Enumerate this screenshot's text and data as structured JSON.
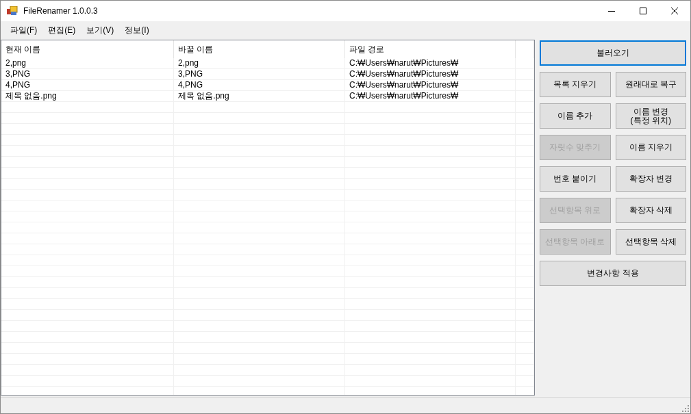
{
  "window": {
    "title": "FileRenamer 1.0.0.3"
  },
  "menu": [
    {
      "label": "파일(F)"
    },
    {
      "label": "편집(E)"
    },
    {
      "label": "보기(V)"
    },
    {
      "label": "정보(I)"
    }
  ],
  "table": {
    "columns": [
      "현재 이름",
      "바꿀 이름",
      "파일 경로"
    ],
    "rows": [
      [
        "2,png",
        "2,png",
        "C:₩Users₩narut₩Pictures₩"
      ],
      [
        "3,PNG",
        "3,PNG",
        "C:₩Users₩narut₩Pictures₩"
      ],
      [
        "4,PNG",
        "4,PNG",
        "C:₩Users₩narut₩Pictures₩"
      ],
      [
        "제목 없음.png",
        "제목 없음.png",
        "C:₩Users₩narut₩Pictures₩"
      ]
    ]
  },
  "buttons": [
    {
      "kind": "wide",
      "label": "불러오기",
      "disabled": false,
      "focused": true
    },
    {
      "kind": "half",
      "label": "목록 지우기",
      "disabled": false,
      "focused": false
    },
    {
      "kind": "half",
      "label": "원래대로 복구",
      "disabled": false,
      "focused": false
    },
    {
      "kind": "half",
      "label": "이름 추가",
      "disabled": false,
      "focused": false
    },
    {
      "kind": "half",
      "label": "이름 변경\n(특정 위치)",
      "disabled": false,
      "focused": false
    },
    {
      "kind": "half",
      "label": "자릿수 맞추기",
      "disabled": true,
      "focused": false
    },
    {
      "kind": "half",
      "label": "이름 지우기",
      "disabled": false,
      "focused": false
    },
    {
      "kind": "half",
      "label": "번호 붙이기",
      "disabled": false,
      "focused": false
    },
    {
      "kind": "half",
      "label": "확장자 변경",
      "disabled": false,
      "focused": false
    },
    {
      "kind": "half",
      "label": "선택항목 위로",
      "disabled": true,
      "focused": false
    },
    {
      "kind": "half",
      "label": "확장자 삭제",
      "disabled": false,
      "focused": false
    },
    {
      "kind": "half",
      "label": "선택항목 아래로",
      "disabled": true,
      "focused": false
    },
    {
      "kind": "half",
      "label": "선택항목 삭제",
      "disabled": false,
      "focused": false
    },
    {
      "kind": "wide",
      "label": "변경사항 적용",
      "disabled": false,
      "focused": false
    }
  ]
}
